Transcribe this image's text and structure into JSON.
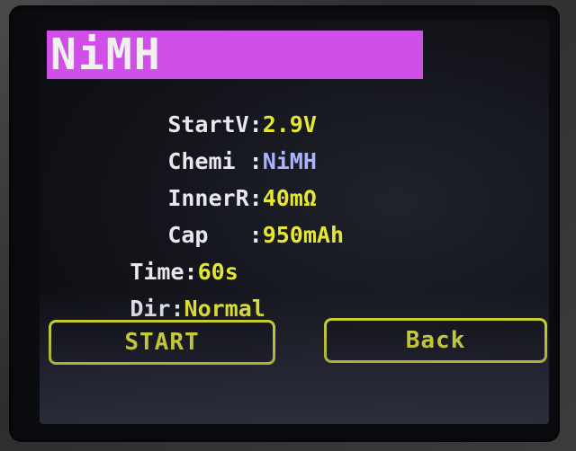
{
  "screen": {
    "title": "NiMH",
    "fields": [
      {
        "label": "StartV",
        "sep": ":",
        "value": "2.9V"
      },
      {
        "label": "Chemi ",
        "sep": ":",
        "value": "NiMH"
      },
      {
        "label": "InnerR",
        "sep": ":",
        "value": "40mΩ"
      },
      {
        "label": "Cap   ",
        "sep": ":",
        "value": "950mAh"
      },
      {
        "label": "Time",
        "sep": ":",
        "value": "60s"
      },
      {
        "label": "Dir",
        "sep": ":",
        "value": "Normal"
      }
    ],
    "buttons": {
      "start": "START",
      "back": "Back"
    }
  },
  "colors": {
    "title_bg": "#cf4fe8",
    "label": "#e8e8ee",
    "value_yellow": "#e6e830",
    "value_blue": "#a8b4ff",
    "button_border": "#d8e02a"
  }
}
